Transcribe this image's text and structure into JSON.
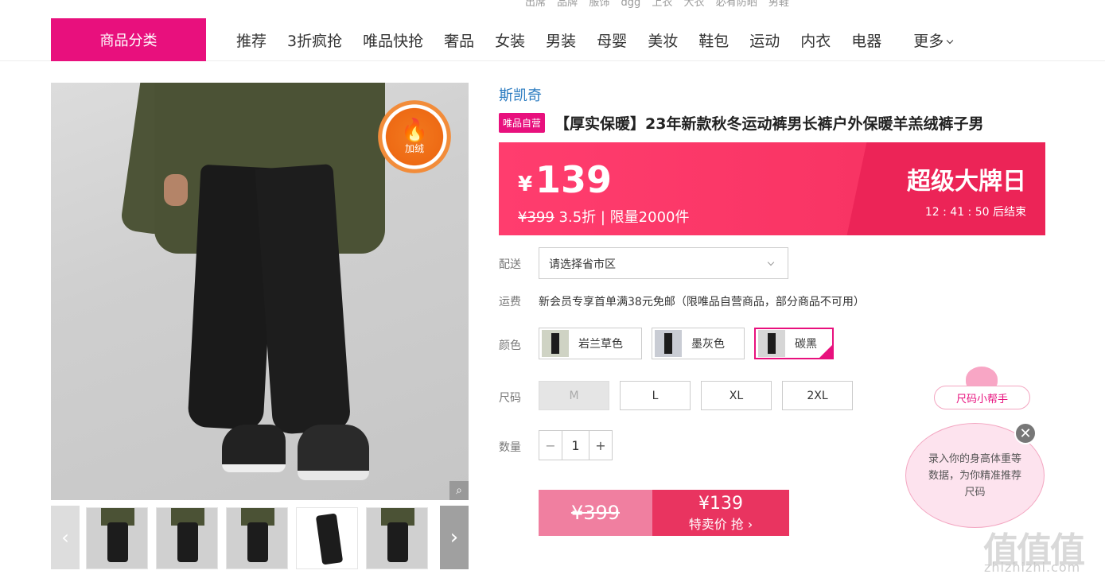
{
  "top_links": [
    "出席",
    "品牌",
    "服饰",
    "dgg",
    "上衣",
    "大衣",
    "必有防晒",
    "男鞋"
  ],
  "nav": {
    "category_label": "商品分类",
    "items": [
      "推荐",
      "3折疯抢",
      "唯品快抢",
      "奢品",
      "女装",
      "男装",
      "母婴",
      "美妆",
      "鞋包",
      "运动",
      "内衣",
      "电器"
    ],
    "more_label": "更多"
  },
  "gallery": {
    "badge_text": "加绒",
    "zoom_icon": "magnifier-icon",
    "prev_arrow": "‹",
    "next_arrow": "›"
  },
  "product": {
    "brand": "斯凯奇",
    "self_operated_tag": "唯品自营",
    "title": "【厚实保暖】23年新款秋冬运动裤男长裤户外保暖羊羔绒裤子男"
  },
  "price_banner": {
    "currency": "¥",
    "price": "139",
    "original_price": "¥399",
    "discount_info": " 3.5折 | 限量2000件",
    "promo_title": "超级大牌日",
    "countdown": "12 : 41 : 50  后结束"
  },
  "delivery": {
    "label": "配送",
    "placeholder": "请选择省市区"
  },
  "shipping": {
    "label": "运费",
    "text": "新会员专享首单满38元免邮（限唯品自营商品，部分商品不可用）"
  },
  "colors": {
    "label": "颜色",
    "options": [
      "岩兰草色",
      "墨灰色",
      "碳黑"
    ],
    "selected": "碳黑"
  },
  "sizes": {
    "label": "尺码",
    "options": [
      "M",
      "L",
      "XL",
      "2XL"
    ],
    "disabled": [
      "M"
    ]
  },
  "quantity": {
    "label": "数量",
    "value": "1",
    "minus": "−",
    "plus": "+"
  },
  "buy": {
    "original_price": "¥399",
    "price": "¥139",
    "action_label": "特卖价 抢 ›"
  },
  "size_helper": {
    "title": "尺码小帮手",
    "message": "录入你的身高体重等数据，为你精准推荐尺码",
    "close": "✕"
  },
  "watermark": {
    "logo": "值值值",
    "site": "zhizhizhi.com"
  },
  "colors_theme": {
    "brand_pink": "#e8107d",
    "banner_red": "#f93565",
    "link_blue": "#2a7bc0"
  }
}
